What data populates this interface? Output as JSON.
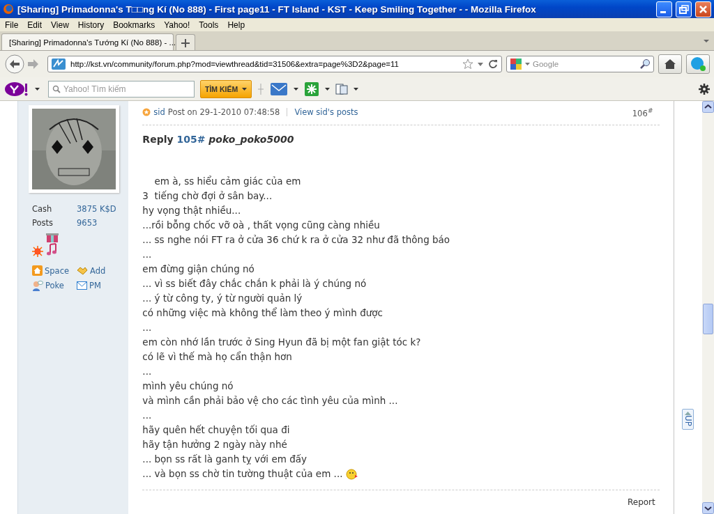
{
  "window": {
    "title": "[Sharing] Primadonna's T□□ng Kí (No 888) - First page11 - FT Island - KST - Keep Smiling Together - - Mozilla Firefox"
  },
  "menu": [
    "File",
    "Edit",
    "View",
    "History",
    "Bookmarks",
    "Yahoo!",
    "Tools",
    "Help"
  ],
  "tab": {
    "label": "[Sharing] Primadonna's Tướng Kí (No 888) - ..."
  },
  "address_bar": {
    "url": "http://kst.vn/community/forum.php?mod=viewthread&tid=31506&extra=page%3D2&page=11"
  },
  "search": {
    "placeholder": "Google"
  },
  "yahoo_toolbar": {
    "placeholder": "Yahoo! Tìm kiếm",
    "button": "TÌM KIẾM"
  },
  "user": {
    "stats": [
      {
        "label": "Cash",
        "value": "3875 K$D"
      },
      {
        "label": "Posts",
        "value": "9653"
      }
    ],
    "actions": [
      {
        "label": "Space",
        "kind": "home"
      },
      {
        "label": "Add",
        "kind": "add"
      },
      {
        "label": "Poke",
        "kind": "poke"
      },
      {
        "label": "PM",
        "kind": "mail"
      }
    ]
  },
  "post": {
    "author": "sid",
    "meta": "Post on 29-1-2010 07:48:58",
    "view_link": "View sid's posts",
    "floor": "106$^{#}$",
    "reply_label": "Reply",
    "reply_link": "105#",
    "reply_to": "poko_poko5000",
    "lines": [
      "    em à, ss hiểu cảm giác của em",
      "3  tiếng chờ đợi ở sân bay...",
      "hy vọng thật nhiều...",
      "...rồi bỗng chốc vỡ oà , thất vọng cũng càng nhiều",
      "... ss nghe nói FT ra ở cửa 36 chứ k ra ở cửa 32 như đã thông báo",
      "...",
      "em đừng giận chúng nó",
      "... vì ss biết đây chắc chắn k phải là ý chúng nó",
      "... ý từ công ty, ý từ người quản lý",
      "có những việc mà không thể làm theo ý mình được",
      "...",
      "em còn nhớ lần trước ở Sing Hyun đã bị một fan giật tóc k?",
      "có lẽ vì thế mà họ cẩn thận hơn",
      "...",
      "mình yêu chúng nó",
      "và mình cần phải bảo vệ cho các tình yêu của mình ...",
      "...",
      "hãy quên hết chuyện tối qua đi",
      "hãy tận hưởng 2 ngày này nhé",
      "... bọn ss rất là ganh tỵ với em đấy",
      "... và bọn ss chờ tin tường thuật của em ..."
    ],
    "report": "Report"
  },
  "up_button": "UP"
}
